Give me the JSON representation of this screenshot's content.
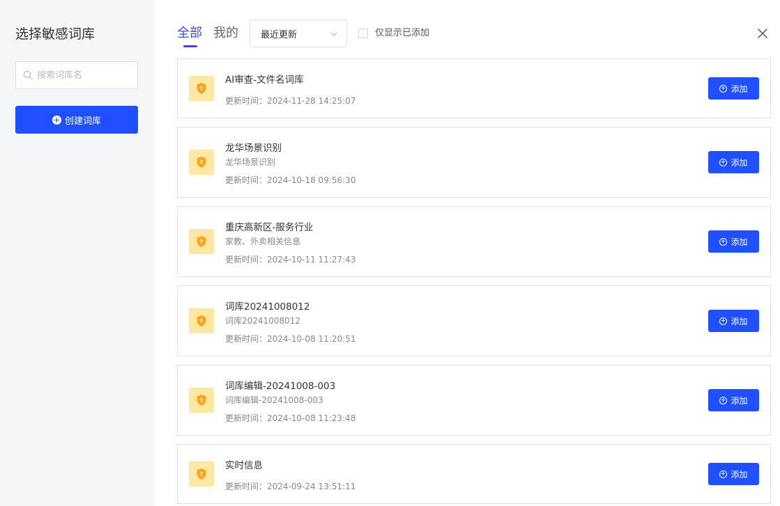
{
  "sidebar": {
    "title": "选择敏感词库",
    "search_placeholder": "搜索词库名",
    "create_label": "创建词库"
  },
  "tabs": [
    {
      "label": "全部",
      "active": true
    },
    {
      "label": "我的",
      "active": false
    }
  ],
  "sort": {
    "selected": "最近更新"
  },
  "filter": {
    "label": "仅显示已添加",
    "checked": false
  },
  "add_label": "添加",
  "libraries": [
    {
      "title": "AI审查-文件名词库",
      "desc": "",
      "time": "更新时间：2024-11-28 14:25:07"
    },
    {
      "title": "龙华场景识别",
      "desc": "龙华场景识别",
      "time": "更新时间：2024-10-18 09:56:30"
    },
    {
      "title": "重庆高新区-服务行业",
      "desc": "家教、外卖相关信息",
      "time": "更新时间：2024-10-11 11:27:43"
    },
    {
      "title": "词库20241008012",
      "desc": "词库20241008012",
      "time": "更新时间：2024-10-08 11:20:51"
    },
    {
      "title": "词库编辑-20241008-003",
      "desc": "词库编辑-20241008-003",
      "time": "更新时间：2024-10-08 11:23:48"
    },
    {
      "title": "实时信息",
      "desc": "",
      "time": "更新时间：2024-09-24 13:51:11"
    }
  ],
  "colors": {
    "primary": "#1f4fff",
    "tab_active": "#3c4bd6",
    "icon_bg": "#fde7a3",
    "icon_shield": "#f5a623"
  }
}
